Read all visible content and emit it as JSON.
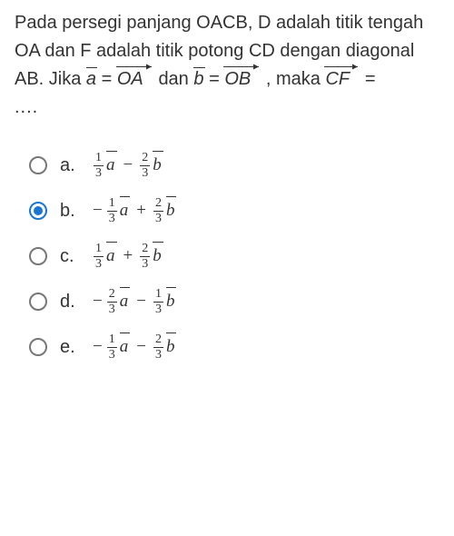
{
  "question": {
    "t1": "Pada persegi panjang OACB, D adalah titik tengah OA dan F adalah titik potong CD dengan diagonal AB. Jika ",
    "a_eq": "a",
    "eq1": " = ",
    "OA": "OA",
    "and": " dan ",
    "b_eq": "b",
    "eq2": " = ",
    "OB": "OB",
    "t2": ", maka ",
    "CF": "CF",
    "eq3": " =",
    "ellipsis": "...."
  },
  "options": [
    {
      "label": "a.",
      "neg1": "",
      "n1": "1",
      "d1": "3",
      "v1": "a",
      "op": "−",
      "neg2": "",
      "n2": "2",
      "d2": "3",
      "v2": "b",
      "selected": false
    },
    {
      "label": "b.",
      "neg1": "−",
      "n1": "1",
      "d1": "3",
      "v1": "a",
      "op": "+",
      "neg2": "",
      "n2": "2",
      "d2": "3",
      "v2": "b",
      "selected": true
    },
    {
      "label": "c.",
      "neg1": "",
      "n1": "1",
      "d1": "3",
      "v1": "a",
      "op": "+",
      "neg2": "",
      "n2": "2",
      "d2": "3",
      "v2": "b",
      "selected": false
    },
    {
      "label": "d.",
      "neg1": "−",
      "n1": "2",
      "d1": "3",
      "v1": "a",
      "op": "−",
      "neg2": "",
      "n2": "1",
      "d2": "3",
      "v2": "b",
      "selected": false
    },
    {
      "label": "e.",
      "neg1": "−",
      "n1": "1",
      "d1": "3",
      "v1": "a",
      "op": "−",
      "neg2": "",
      "n2": "2",
      "d2": "3",
      "v2": "b",
      "selected": false
    }
  ]
}
